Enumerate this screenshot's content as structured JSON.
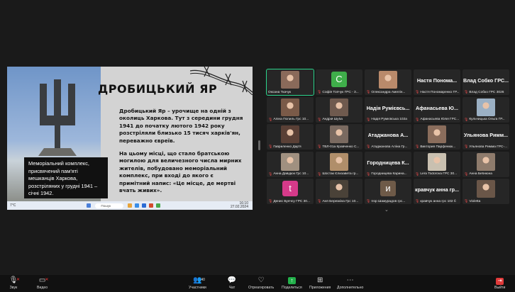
{
  "slide": {
    "title": "ДРОБИЦЬКИЙ ЯР",
    "paragraph1": "Дробицький Яр – урочище на одній з околиць Харкова. Тут з середини грудня 1941 до початку лютого 1942 року розстріляли близько 15 тисяч харків'ян, переважно євреїв.",
    "paragraph2": "На цьому місці, що стало братською могилою для величезного числа мирних жителів, побудовано меморіальний комплекс, при вході до якого є примітний напис: «Це місце, де мертві вчать живих».",
    "caption": "Меморіальний комплекс, присвячений пам'яті мешканців Харкова, розстріляних у грудні 1941 – січні 1942.",
    "taskbar": {
      "temp": "7°C",
      "search": "Пошук",
      "clock_time": "16:10",
      "clock_date": "27.02.2024"
    }
  },
  "participants": [
    {
      "name": "Оксана Ткачук",
      "kind": "video",
      "color": "#8a6a5a",
      "active": true
    },
    {
      "name": "Софія Топчук ГРС - 3...",
      "kind": "avatar",
      "letter": "C",
      "color": "#3fae4a"
    },
    {
      "name": "Олександра Амелін...",
      "kind": "video",
      "color": "#b98a6b"
    },
    {
      "name": "Настя Пономаренко ГР...",
      "kind": "text",
      "big": "Настя Понома..."
    },
    {
      "name": "Влад Собко ГРС 3026",
      "kind": "text",
      "big": "Влад Собко ГРС..."
    },
    {
      "name": "Аліна Попиль Грс 10...",
      "kind": "video",
      "color": "#7a5a48"
    },
    {
      "name": "Андрій Шуба",
      "kind": "video",
      "color": "#6f5a4e"
    },
    {
      "name": "Надія Румієвська 102а",
      "kind": "text",
      "big": "Надія Румієвсь..."
    },
    {
      "name": "Афанасьева Юлія ГРС...",
      "kind": "text",
      "big": "Афанасьева Ю..."
    },
    {
      "name": "Кульчицька Ольга ГР...",
      "kind": "video",
      "color": "#9bb0c4"
    },
    {
      "name": "Гавриленко Дар'я",
      "kind": "video",
      "color": "#5a4036"
    },
    {
      "name": "ТВЛ-01а Кравченко С...",
      "kind": "video",
      "color": "#7a6a60"
    },
    {
      "name": "Атаджанова Аліна Гр...",
      "kind": "text",
      "big": "Атаджанова А..."
    },
    {
      "name": "Виктория Парфенюк...",
      "kind": "video",
      "color": "#8a6d5c"
    },
    {
      "name": "Ульянова Римма ГРС-...",
      "kind": "text",
      "big": "Ульянова Римм..."
    },
    {
      "name": "Анна Давідюк Грс 10...",
      "kind": "video",
      "color": "#a09080"
    },
    {
      "name": "Шостак Єлизавета гр...",
      "kind": "video",
      "color": "#b08e6a"
    },
    {
      "name": "Городницева Карина...",
      "kind": "text",
      "big": "Городницева К..."
    },
    {
      "name": "Lera Todorova ГРС 30...",
      "kind": "video",
      "color": "#c9c0b0"
    },
    {
      "name": "Анна Бебнюна",
      "kind": "video",
      "color": "#8e7b6c"
    },
    {
      "name": "Денис Бунчєу ГРС 30...",
      "kind": "avatar",
      "letter": "t",
      "color": "#d63a8a"
    },
    {
      "name": "Аня Березкіна Грс 10...",
      "kind": "video",
      "color": "#4a4238"
    },
    {
      "name": "Ігор Шамурадов грс...",
      "kind": "avatar",
      "letter": "и",
      "color": "#6e5a48"
    },
    {
      "name": "кравчук анна грс 102 б",
      "kind": "text",
      "big": "кравчук анна гр..."
    },
    {
      "name": "Violetta",
      "kind": "video",
      "color": "#6a5648"
    }
  ],
  "toolbar": {
    "audio": "Звук",
    "video": "Видео",
    "participants": "Участники",
    "participants_count": "40",
    "chat": "Чат",
    "reactions": "Отреагировать",
    "share": "Поделиться",
    "apps": "Приложения",
    "more": "Дополнительно",
    "leave": "Выйти"
  },
  "colors": {
    "active_speaker": "#2bd48c",
    "share_green": "#22b04a",
    "leave_red": "#e03a3a",
    "muted_red": "#e04848"
  }
}
